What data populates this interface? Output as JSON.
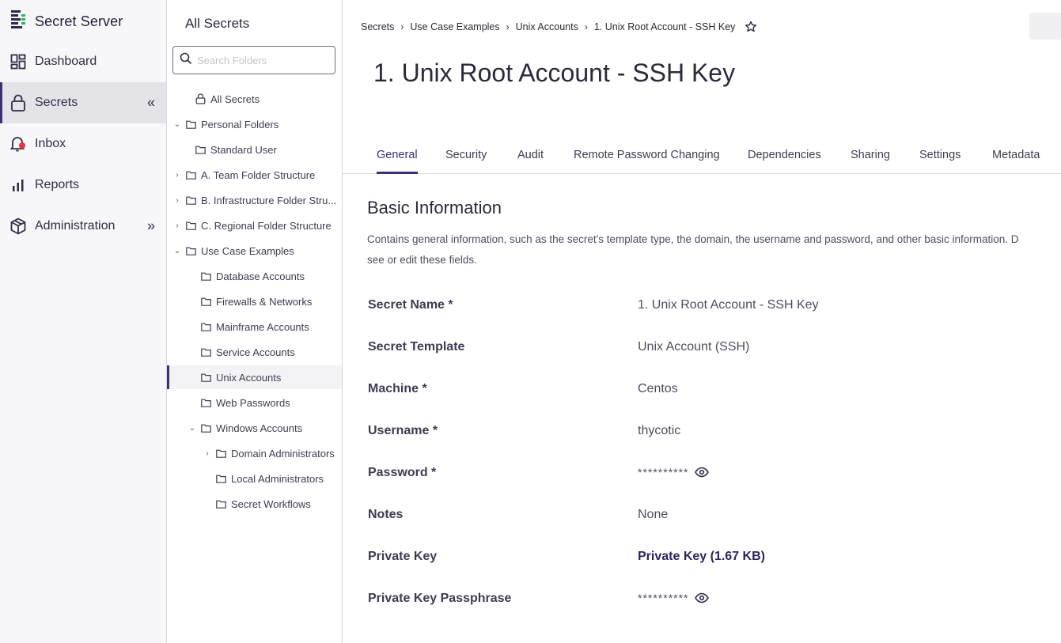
{
  "app": {
    "name": "Secret Server"
  },
  "nav": {
    "items": [
      {
        "label": "Dashboard",
        "icon": "dashboard-icon"
      },
      {
        "label": "Secrets",
        "icon": "lock-icon",
        "active": true,
        "chevron": "«"
      },
      {
        "label": "Inbox",
        "icon": "bell-icon",
        "badge_color": "#e8343f"
      },
      {
        "label": "Reports",
        "icon": "bar-chart-icon"
      },
      {
        "label": "Administration",
        "icon": "cube-icon",
        "chevron": "»"
      }
    ]
  },
  "folders": {
    "title": "All Secrets",
    "search_placeholder": "Search Folders",
    "tree": [
      {
        "label": "All Secrets",
        "icon": "lock-icon",
        "toggle": ""
      },
      {
        "label": "Personal Folders",
        "icon": "folder-icon",
        "toggle": "⌄"
      },
      {
        "label": "Standard User",
        "icon": "folder-icon",
        "toggle": ""
      },
      {
        "label": "A. Team Folder Structure",
        "icon": "folder-icon",
        "toggle": "›"
      },
      {
        "label": "B. Infrastructure Folder Stru...",
        "icon": "folder-icon",
        "toggle": "›"
      },
      {
        "label": "C. Regional Folder Structure",
        "icon": "folder-icon",
        "toggle": "›"
      },
      {
        "label": "Use Case Examples",
        "icon": "folder-icon",
        "toggle": "⌄"
      },
      {
        "label": "Database Accounts",
        "icon": "folder-icon",
        "toggle": ""
      },
      {
        "label": "Firewalls & Networks",
        "icon": "folder-icon",
        "toggle": ""
      },
      {
        "label": "Mainframe Accounts",
        "icon": "folder-icon",
        "toggle": ""
      },
      {
        "label": "Service Accounts",
        "icon": "folder-icon",
        "toggle": ""
      },
      {
        "label": "Unix Accounts",
        "icon": "folder-icon",
        "toggle": "",
        "selected": true
      },
      {
        "label": "Web Passwords",
        "icon": "folder-icon",
        "toggle": ""
      },
      {
        "label": "Windows Accounts",
        "icon": "folder-icon",
        "toggle": "⌄"
      },
      {
        "label": "Domain Administrators",
        "icon": "folder-icon",
        "toggle": "›"
      },
      {
        "label": "Local Administrators",
        "icon": "folder-icon",
        "toggle": ""
      },
      {
        "label": "Secret Workflows",
        "icon": "folder-icon",
        "toggle": ""
      }
    ]
  },
  "breadcrumb": {
    "items": [
      "Secrets",
      "Use Case Examples",
      "Unix Accounts",
      "1. Unix Root Account - SSH Key"
    ],
    "separator": "›"
  },
  "secret": {
    "title": "1. Unix Root Account - SSH Key"
  },
  "tabs": [
    "General",
    "Security",
    "Audit",
    "Remote Password Changing",
    "Dependencies",
    "Sharing",
    "Settings",
    "Metadata"
  ],
  "basic_info": {
    "title": "Basic Information",
    "description_line1": "Contains general information, such as the secret's template type, the domain, the username and password, and other basic information. D",
    "description_line2": "see or edit these fields."
  },
  "fields": [
    {
      "label": "Secret Name *",
      "value": "1. Unix Root Account - SSH Key"
    },
    {
      "label": "Secret Template",
      "value": "Unix Account (SSH)"
    },
    {
      "label": "Machine *",
      "value": "Centos"
    },
    {
      "label": "Username *",
      "value": "thycotic"
    },
    {
      "label": "Password *",
      "value": "**********",
      "reveal_icon": "eye-icon"
    },
    {
      "label": "Notes",
      "value": "None"
    },
    {
      "label": "Private Key",
      "value": "Private Key (1.67 KB)",
      "link": true
    },
    {
      "label": "Private Key Passphrase",
      "value": "**********",
      "reveal_icon": "eye-icon"
    }
  ],
  "colors": {
    "accent": "#3b2f7a",
    "brand_green": "#2fb56a",
    "alert_red": "#e8343f"
  }
}
